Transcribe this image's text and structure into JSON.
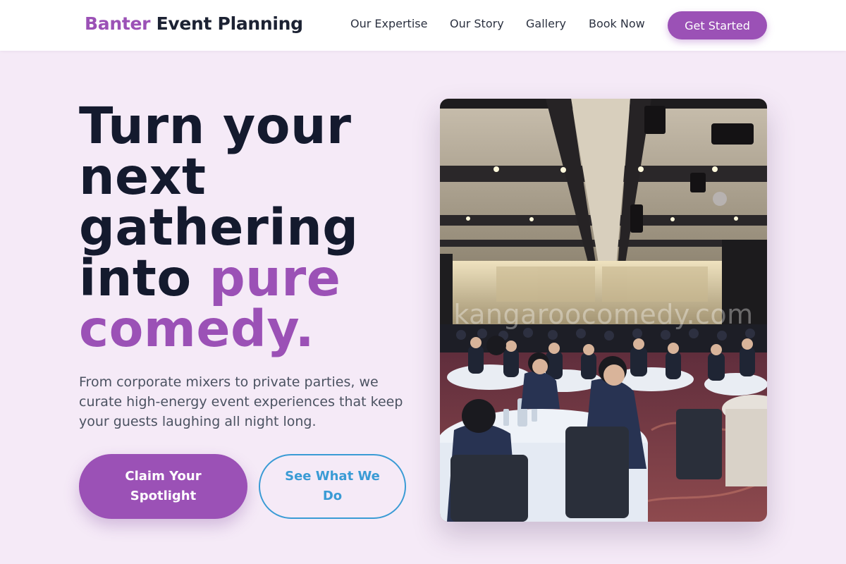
{
  "header": {
    "brand_accent": "Banter",
    "brand_rest": "Event Planning",
    "nav": [
      "Our Expertise",
      "Our Story",
      "Gallery",
      "Book Now"
    ],
    "cta_label": "Get Started"
  },
  "hero": {
    "headline_lead": "Turn your next gathering into ",
    "headline_highlight": "pure comedy.",
    "subtext": "From corporate mixers to private parties, we curate high-energy event experiences that keep your guests laughing all night long.",
    "primary_button": "Claim Your Spotlight",
    "secondary_button": "See What We Do",
    "image_watermark": "kangaroocomedy.com"
  },
  "colors": {
    "accent": "#9b51b6",
    "secondary": "#3a9bd5",
    "background": "#f5eaf7",
    "heading": "#141a2e"
  }
}
